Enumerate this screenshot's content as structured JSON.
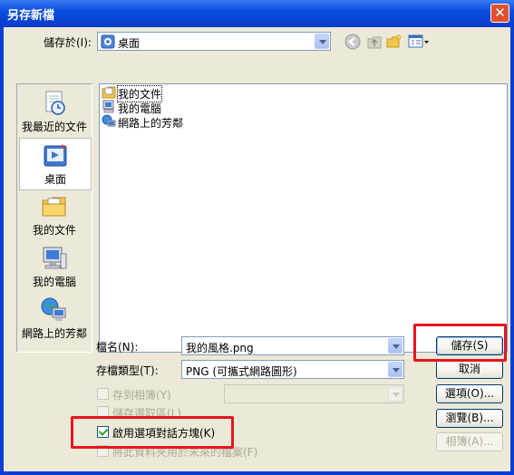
{
  "window": {
    "title": "另存新檔",
    "close_glyph": "✕"
  },
  "save_in": {
    "label": "儲存於(I):",
    "value": "桌面"
  },
  "places": [
    {
      "label": "我最近的文件",
      "icon": "recent-documents-icon"
    },
    {
      "label": "桌面",
      "icon": "desktop-icon",
      "selected": true
    },
    {
      "label": "我的文件",
      "icon": "my-documents-icon"
    },
    {
      "label": "我的電腦",
      "icon": "my-computer-icon"
    },
    {
      "label": "網路上的芳鄰",
      "icon": "network-places-icon"
    }
  ],
  "files": [
    {
      "name": "我的文件",
      "icon": "my-documents-icon"
    },
    {
      "name": "我的電腦",
      "icon": "my-computer-icon"
    },
    {
      "name": "網路上的芳鄰",
      "icon": "network-places-icon"
    }
  ],
  "filename": {
    "label": "檔名(N):",
    "value": "我的風格.png"
  },
  "filetype": {
    "label": "存檔類型(T):",
    "value": "PNG (可攜式網路圖形)"
  },
  "buttons": {
    "save": "儲存(S)",
    "cancel": "取消",
    "options": "選項(O)...",
    "browse": "瀏覽(B)...",
    "album": "相簿(A)..."
  },
  "options": {
    "save_to_album": "存到相簿(Y)",
    "save_selection": "儲存選取區(L)",
    "enable_options_dialog": "啟用選項對話方塊(K)",
    "enable_options_checked": true,
    "apply_to_file": "將此資料夾用於未來的檔案(F)"
  },
  "colors": {
    "titlebar": "#0a45d6",
    "dialog_bg": "#ece9d8",
    "highlight": "#e8141e"
  }
}
